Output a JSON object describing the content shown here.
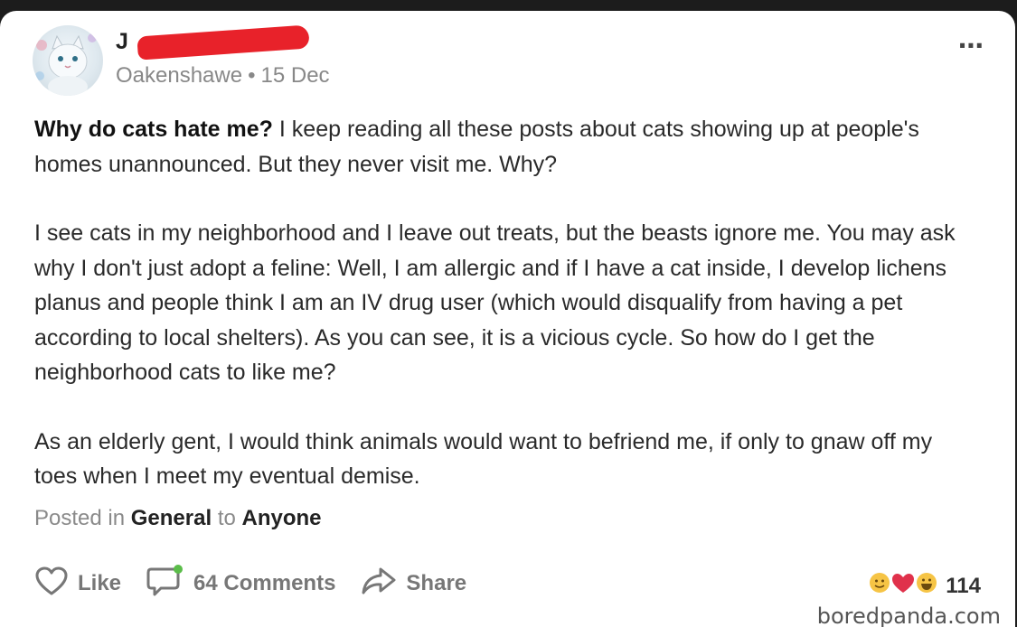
{
  "post": {
    "author_visible": "J",
    "location": "Oakenshawe",
    "date": "15 Dec",
    "separator": "•",
    "more_icon": "⋯",
    "title": "Why do cats hate me?",
    "paragraph1_rest": " I keep reading all these posts about cats showing up at people's homes unannounced. But they never visit me. Why?",
    "paragraph2": "I see cats in my neighborhood and I leave out treats, but the beasts ignore me. You may ask why I don't just adopt a feline: Well, I am allergic and if I have a cat inside, I develop lichens planus and people think I am an IV drug user (which would disqualify from having a pet according to local shelters). As you can see, it is a vicious cycle. So how do I get the neighborhood cats to like me?",
    "paragraph3": "As an elderly gent, I would think animals would want to befriend me, if only to gnaw off my toes when I meet my eventual demise."
  },
  "footer": {
    "posted_in": "Posted in",
    "category": "General",
    "to": "to",
    "audience": "Anyone"
  },
  "actions": {
    "like": "Like",
    "comments": "64 Comments",
    "share": "Share"
  },
  "reactions": {
    "count": "114"
  },
  "watermark": "boredpanda.com",
  "colors": {
    "redaction": "#e8222a",
    "comment_dot": "#5bbd4a",
    "heart": "#e0314b",
    "emoji": "#f6c445"
  }
}
